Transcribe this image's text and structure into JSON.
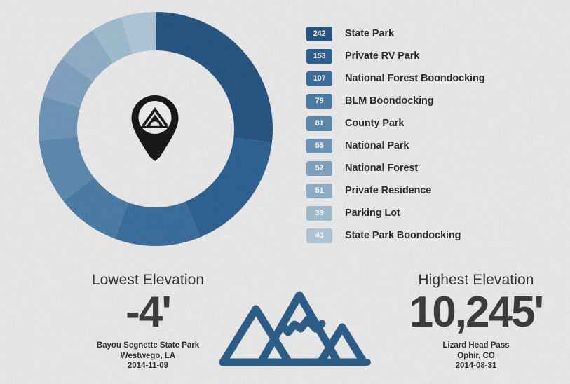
{
  "background_color": "#e9e9e9",
  "chart_data": {
    "type": "pie",
    "title": "",
    "subtype": "donut",
    "legend_position": "right",
    "start_angle_deg": 0,
    "direction": "clockwise",
    "categories": [
      "State Park",
      "Private RV Park",
      "National Forest Boondocking",
      "BLM Boondocking",
      "County Park",
      "National Park",
      "National Forest",
      "Private Residence",
      "Parking Lot",
      "State Park Boondocking"
    ],
    "values": [
      242,
      153,
      107,
      79,
      81,
      55,
      52,
      51,
      39,
      43
    ],
    "colors": [
      "#255480",
      "#2d6091",
      "#3a6d9b",
      "#4a7aa4",
      "#5c87ad",
      "#6d94b6",
      "#7fa1bf",
      "#8fadc6",
      "#9fbacf",
      "#afc6d7"
    ],
    "total": 902
  },
  "legend": {
    "items": [
      {
        "count": "242",
        "label": "State Park",
        "color": "#255480"
      },
      {
        "count": "153",
        "label": "Private RV Park",
        "color": "#2d6091"
      },
      {
        "count": "107",
        "label": "National Forest Boondocking",
        "color": "#3a6d9b"
      },
      {
        "count": "79",
        "label": "BLM Boondocking",
        "color": "#4a7aa4"
      },
      {
        "count": "81",
        "label": "County Park",
        "color": "#5c87ad"
      },
      {
        "count": "55",
        "label": "National Park",
        "color": "#6d94b6"
      },
      {
        "count": "52",
        "label": "National Forest",
        "color": "#7fa1bf"
      },
      {
        "count": "51",
        "label": "Private Residence",
        "color": "#8fadc6"
      },
      {
        "count": "39",
        "label": "Parking Lot",
        "color": "#9fbacf"
      },
      {
        "count": "43",
        "label": "State Park Boondocking",
        "color": "#afc6d7"
      }
    ]
  },
  "elevation": {
    "lowest": {
      "title": "Lowest Elevation",
      "value": "-4'",
      "place": "Bayou Segnette State Park",
      "location": "Westwego, LA",
      "date": "2014-11-09"
    },
    "highest": {
      "title": "Highest Elevation",
      "value": "10,245'",
      "place": "Lizard Head Pass",
      "location": "Ophir, CO",
      "date": "2014-08-31"
    },
    "icon_color": "#2b5b88"
  },
  "icons": {
    "center": "map-pin-tent-icon",
    "mountain": "mountain-icon"
  }
}
